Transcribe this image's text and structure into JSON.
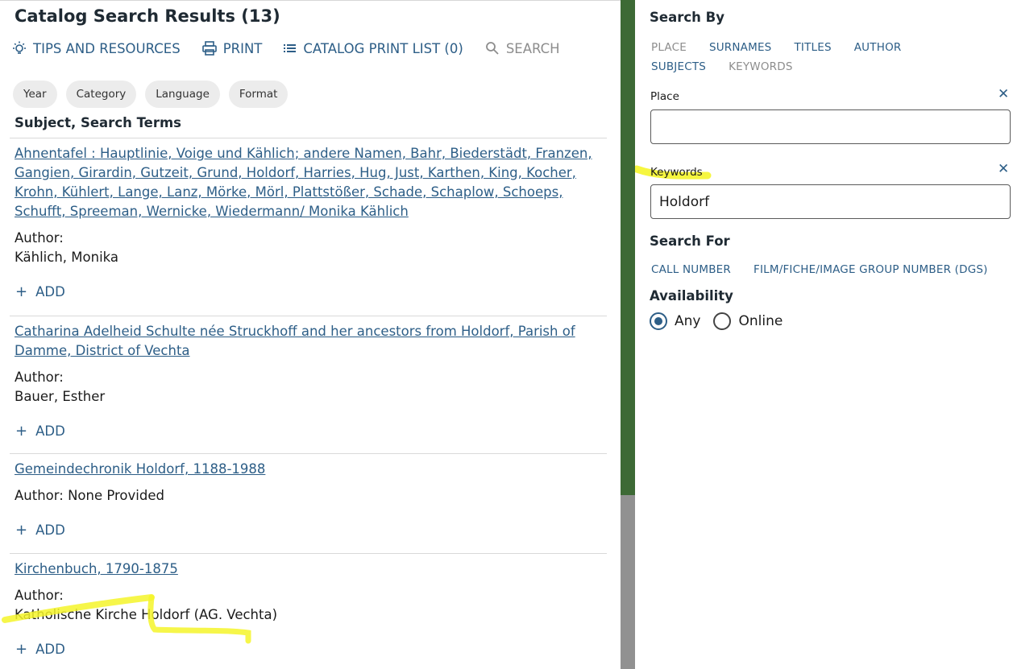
{
  "results_panel": {
    "title": "Catalog Search Results (13)",
    "actions": {
      "tips": "TIPS AND RESOURCES",
      "print": "PRINT",
      "print_list": "CATALOG PRINT LIST (0)",
      "search": "SEARCH"
    },
    "filters": [
      "Year",
      "Category",
      "Language",
      "Format"
    ],
    "subheading": "Subject, Search Terms",
    "author_label": "Author:",
    "add_label": "ADD",
    "results": [
      {
        "title": "Ahnentafel : Hauptlinie, Voige und Kählich; andere Namen, Bahr, Biederstädt, Franzen, Gangien, Girardin, Gutzeit, Grund, Holdorf, Harries, Hug, Just, Karthen, King, Kocher, Krohn, Kühlert, Lange, Lanz, Mörke, Mörl, Plattstößer, Schade, Schaplow, Schoeps, Schufft, Spreeman, Wernicke, Wiedermann/ Monika Kählich",
        "author": "Kählich, Monika"
      },
      {
        "title": "Catharina Adelheid Schulte née Struckhoff and her ancestors from Holdorf, Parish of Damme, District of Vechta",
        "author": "Bauer, Esther"
      },
      {
        "title": "Gemeindechronik Holdorf, 1188-1988",
        "author_inline": "Author: None Provided"
      },
      {
        "title": "Kirchenbuch, 1790-1875",
        "author": "Katholische Kirche Holdorf (AG. Vechta)"
      }
    ]
  },
  "search_panel": {
    "search_by_heading": "Search By",
    "search_by_tabs": [
      {
        "label": "PLACE",
        "active": false
      },
      {
        "label": "SURNAMES",
        "active": true
      },
      {
        "label": "TITLES",
        "active": true
      },
      {
        "label": "AUTHOR",
        "active": true
      },
      {
        "label": "SUBJECTS",
        "active": true
      },
      {
        "label": "KEYWORDS",
        "active": false
      }
    ],
    "place_label": "Place",
    "place_value": "",
    "keywords_label": "Keywords",
    "keywords_value": "Holdorf",
    "close_glyph": "✕",
    "search_for_heading": "Search For",
    "search_for_tabs": [
      "CALL NUMBER",
      "FILM/FICHE/IMAGE GROUP NUMBER (DGS)"
    ],
    "availability_heading": "Availability",
    "availability_options": [
      {
        "label": "Any",
        "checked": true
      },
      {
        "label": "Online",
        "checked": false
      }
    ]
  },
  "colors": {
    "link": "#2d5e87",
    "muted": "#8d8d8d",
    "scroll_track": "#3d6a35",
    "scroll_thumb": "#919191",
    "highlighter": "#f5f52a"
  }
}
